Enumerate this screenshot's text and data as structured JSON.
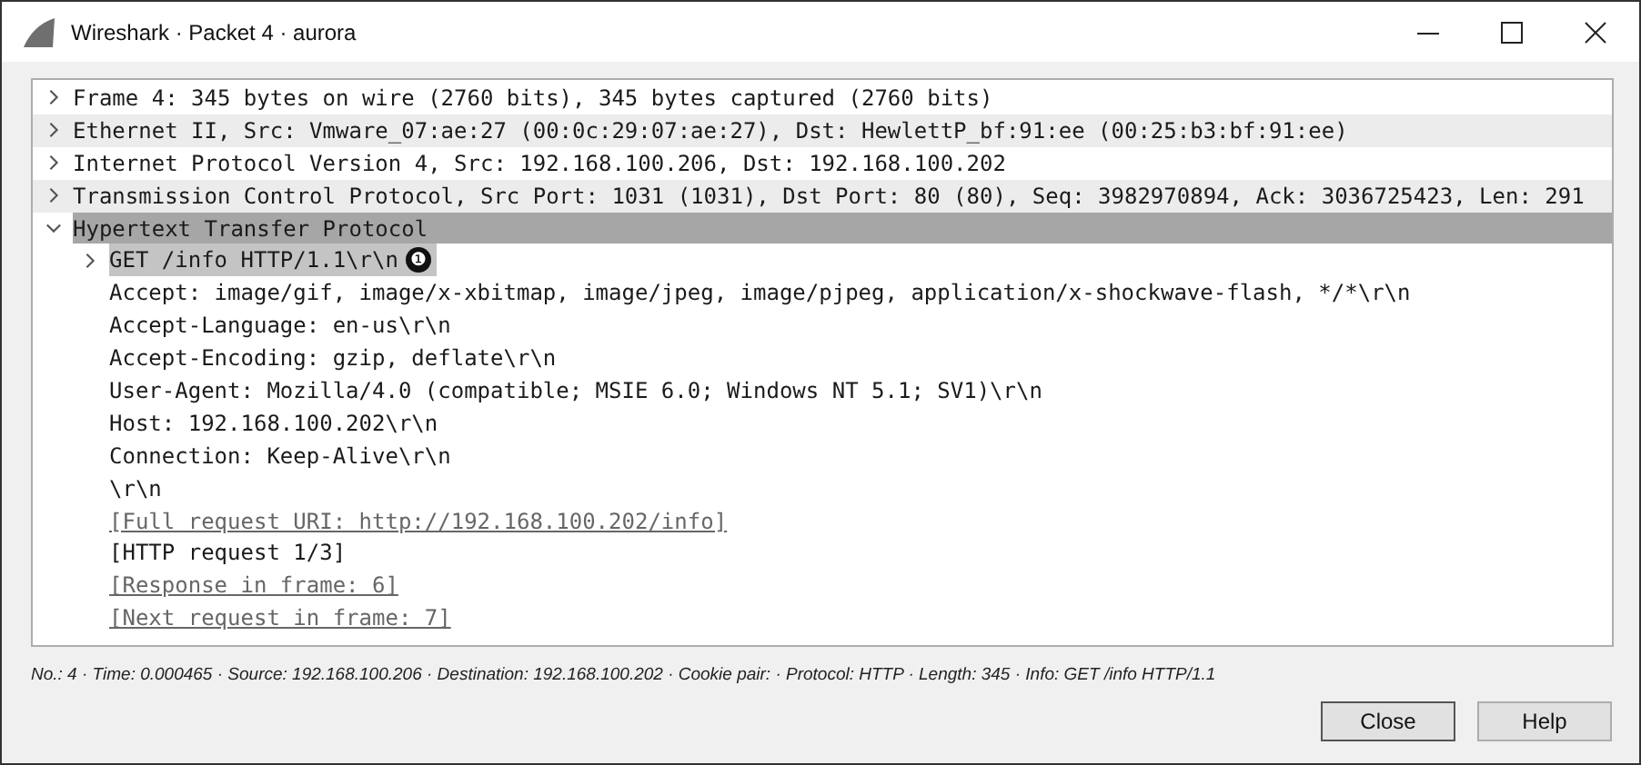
{
  "window": {
    "title": "Wireshark · Packet 4 · aurora"
  },
  "tree": [
    {
      "text": "Frame 4: 345 bytes on wire (2760 bits), 345 bytes captured (2760 bits)",
      "expanded": false,
      "selected": false
    },
    {
      "text": "Ethernet II, Src: Vmware_07:ae:27 (00:0c:29:07:ae:27), Dst: HewlettP_bf:91:ee (00:25:b3:bf:91:ee)",
      "expanded": false,
      "selected": false
    },
    {
      "text": "Internet Protocol Version 4, Src: 192.168.100.206, Dst: 192.168.100.202",
      "expanded": false,
      "selected": false
    },
    {
      "text": "Transmission Control Protocol, Src Port: 1031 (1031), Dst Port: 80 (80), Seq: 3982970894, Ack: 3036725423, Len: 291",
      "expanded": false,
      "selected": false
    },
    {
      "text": "Hypertext Transfer Protocol",
      "expanded": true,
      "selected": true,
      "children": [
        {
          "kind": "field",
          "text": "GET /info HTTP/1.1\\r\\n",
          "callout": "❶",
          "expanded": false,
          "selected": true
        },
        {
          "kind": "field",
          "text": "Accept: image/gif, image/x-xbitmap, image/jpeg, image/pjpeg, application/x-shockwave-flash, */*\\r\\n",
          "selected": false
        },
        {
          "kind": "field",
          "text": "Accept-Language: en-us\\r\\n",
          "selected": false
        },
        {
          "kind": "field",
          "text": "Accept-Encoding: gzip, deflate\\r\\n",
          "selected": false
        },
        {
          "kind": "field",
          "text": "User-Agent: Mozilla/4.0 (compatible; MSIE 6.0; Windows NT 5.1; SV1)\\r\\n",
          "selected": false
        },
        {
          "kind": "field",
          "text": "Host: 192.168.100.202\\r\\n",
          "selected": false
        },
        {
          "kind": "field",
          "text": "Connection: Keep-Alive\\r\\n",
          "selected": false
        },
        {
          "kind": "field",
          "text": "\\r\\n",
          "selected": false
        },
        {
          "kind": "link",
          "text": "[Full request URI: http://192.168.100.202/info]",
          "selected": false
        },
        {
          "kind": "field",
          "text": "[HTTP request 1/3]",
          "selected": false
        },
        {
          "kind": "link",
          "text": "[Response in frame: 6]",
          "selected": false
        },
        {
          "kind": "link",
          "text": "[Next request in frame: 7]",
          "selected": false
        }
      ]
    }
  ],
  "status_bar": "No.: 4 · Time: 0.000465 · Source: 192.168.100.206 · Destination: 192.168.100.202 · Cookie pair: · Protocol: HTTP · Length: 345 · Info: GET /info HTTP/1.1",
  "buttons": [
    {
      "label": "Close",
      "default": true
    },
    {
      "label": "Help",
      "default": false
    }
  ]
}
